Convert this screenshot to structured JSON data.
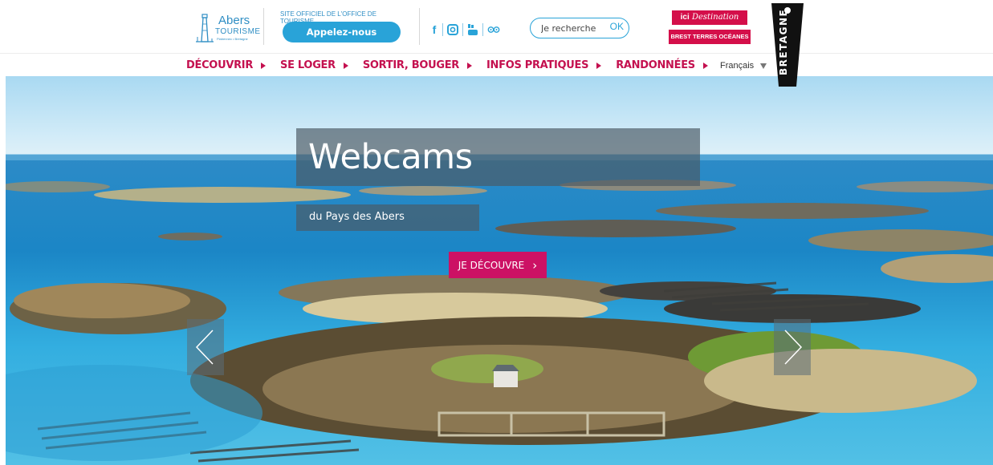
{
  "header": {
    "logo": {
      "name": "Abers",
      "tagline": "TOURISME",
      "region": "Plabennec • Bretagne"
    },
    "official_label": "SITE OFFICIEL DE L'OFFICE DE TOURISME",
    "call_button": "Appelez-nous",
    "social_icons": [
      "facebook-icon",
      "instagram-icon",
      "youtube-icon",
      "tripadvisor-icon"
    ],
    "search": {
      "placeholder": "Je recherche",
      "submit": "OK"
    },
    "destination": {
      "line1_prefix": "ici",
      "line1": "Destination",
      "line2": "BREST TERRES OCÉANES"
    },
    "bretagne": "BRETAGNE"
  },
  "nav": {
    "items": [
      {
        "label": "DÉCOUVRIR"
      },
      {
        "label": "SE LOGER"
      },
      {
        "label": "SORTIR, BOUGER"
      },
      {
        "label": "INFOS PRATIQUES"
      },
      {
        "label": "RANDONNÉES"
      }
    ],
    "language": "Français"
  },
  "hero": {
    "title": "Webcams",
    "subtitle": "du Pays des Abers",
    "cta": "JE DÉCOUVRE",
    "cta_icon": "chevron-right-icon",
    "prev_icon": "chevron-left-icon",
    "next_icon": "chevron-right-icon"
  },
  "colors": {
    "accent_pink": "#c4104f",
    "button_blue": "#29a3d8",
    "cta_magenta": "#cc1164"
  }
}
